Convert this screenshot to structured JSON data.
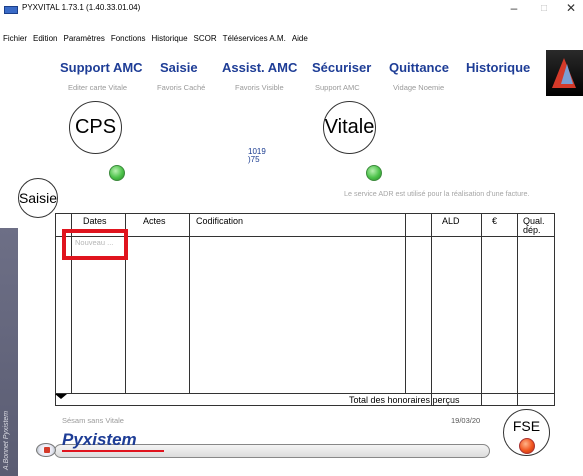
{
  "window": {
    "title": "PYXVITAL 1.73.1 (1.40.33.01.04)",
    "minimize": "–",
    "maximize": "□",
    "close": "✕"
  },
  "menu": [
    "Fichier",
    "Edition",
    "Paramètres",
    "Fonctions",
    "Historique",
    "SCOR",
    "Téléservices A.M.",
    "Aide"
  ],
  "nav": {
    "main": [
      "Support AMC",
      "Saisie",
      "Assist. AMC",
      "Sécuriser",
      "Quittance",
      "Historique"
    ],
    "sub": [
      "Editer carte Vitale",
      "Favoris Caché",
      "Favoris Visible",
      "Support AMC",
      "Vidage Noemie"
    ]
  },
  "cards": {
    "cps_label": "CPS",
    "vitale_label": "Vitale",
    "saisie_label": "Saisie",
    "code_line1": "1019",
    "code_line2": ")75"
  },
  "adr_message": "Le service ADR est utilisé pour la réalisation d'une facture.",
  "table": {
    "headers": [
      "Dates",
      "Actes",
      "Codification",
      "ALD",
      "€",
      "Qual. dép."
    ],
    "new_row_placeholder": "Nouveau ...",
    "total_label": "Total des honoraires perçus"
  },
  "footer": {
    "sesam": "Sésam sans Vitale",
    "date": "19/03/20",
    "brand": "Pyxistem",
    "fse_label": "FSE",
    "side_text": "A.Bonnet Pyxistem"
  },
  "colors": {
    "nav_blue": "#1e3d96",
    "highlight_red": "#e0141e",
    "led_green": "#4cc24a",
    "led_red": "#f0541e"
  }
}
